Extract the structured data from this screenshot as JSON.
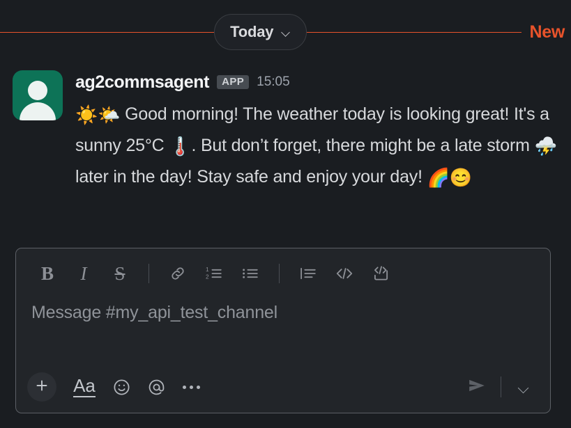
{
  "divider": {
    "date_label": "Today",
    "new_label": "New",
    "accent_color": "#e8532b",
    "chevron_icon": "chevron-down-icon"
  },
  "message": {
    "avatar_icon": "user-avatar-icon",
    "avatar_color": "#0d7357",
    "sender": "ag2commsagent",
    "badge": "APP",
    "timestamp": "15:05",
    "text_segments": [
      {
        "type": "emoji",
        "value": "☀️",
        "name": "sun-emoji"
      },
      {
        "type": "emoji",
        "value": "🌤️",
        "name": "sun-behind-cloud-emoji"
      },
      {
        "type": "text",
        "value": " Good morning! The weather today is looking great! It's a sunny 25°C "
      },
      {
        "type": "emoji",
        "value": "🌡️",
        "name": "thermometer-emoji"
      },
      {
        "type": "text",
        "value": ". But don’t forget, there might be a late storm "
      },
      {
        "type": "emoji",
        "value": "⛈️",
        "name": "cloud-with-lightning-and-rain-emoji"
      },
      {
        "type": "text",
        "value": " later in the day! Stay safe and enjoy your day! "
      },
      {
        "type": "emoji",
        "value": "🌈",
        "name": "rainbow-emoji"
      },
      {
        "type": "emoji",
        "value": "😊",
        "name": "smiling-face-with-smiling-eyes-emoji"
      }
    ]
  },
  "composer": {
    "placeholder": "Message #my_api_test_channel",
    "format_buttons": [
      {
        "name": "bold-button",
        "label": "B"
      },
      {
        "name": "italic-button",
        "label": "I"
      },
      {
        "name": "strikethrough-button",
        "label": "S"
      },
      {
        "name": "link-button",
        "label": ""
      },
      {
        "name": "ordered-list-button",
        "label": ""
      },
      {
        "name": "bulleted-list-button",
        "label": ""
      },
      {
        "name": "blockquote-button",
        "label": ""
      },
      {
        "name": "code-button",
        "label": ""
      },
      {
        "name": "code-block-button",
        "label": ""
      }
    ],
    "action_buttons": [
      {
        "name": "add-attachment-button",
        "label": "+"
      },
      {
        "name": "formatting-toggle-button",
        "label": "Aa"
      },
      {
        "name": "emoji-button",
        "label": ""
      },
      {
        "name": "mention-button",
        "label": "@"
      },
      {
        "name": "more-options-button",
        "label": ""
      }
    ],
    "send_button": "send-button",
    "send_options_button": "send-options-button"
  }
}
